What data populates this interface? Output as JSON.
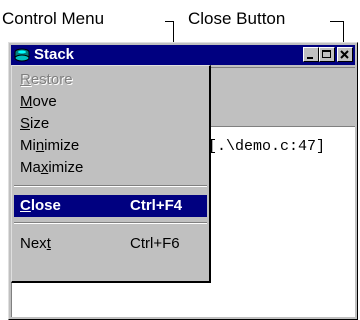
{
  "callouts": {
    "control_menu": "Control Menu",
    "close_button": "Close Button"
  },
  "window": {
    "title": "Stack",
    "code_line": "[.\\demo.c:47]"
  },
  "control_menu": {
    "items": [
      {
        "label": "Restore",
        "mnemonic_index": 0,
        "enabled": false
      },
      {
        "label": "Move",
        "mnemonic_index": 0,
        "enabled": true
      },
      {
        "label": "Size",
        "mnemonic_index": 0,
        "enabled": true
      },
      {
        "label": "Minimize",
        "mnemonic_index": 2,
        "enabled": true
      },
      {
        "label": "Maximize",
        "mnemonic_index": 2,
        "enabled": true
      },
      {
        "label": "Close",
        "shortcut": "Ctrl+F4",
        "mnemonic_index": 0,
        "enabled": true,
        "selected": true
      },
      {
        "label": "Next",
        "shortcut": "Ctrl+F6",
        "mnemonic_index": 3,
        "enabled": true
      }
    ]
  },
  "colors": {
    "titlebar": "#000080",
    "menu_highlight": "#000080",
    "face": "#c0c0c0"
  }
}
